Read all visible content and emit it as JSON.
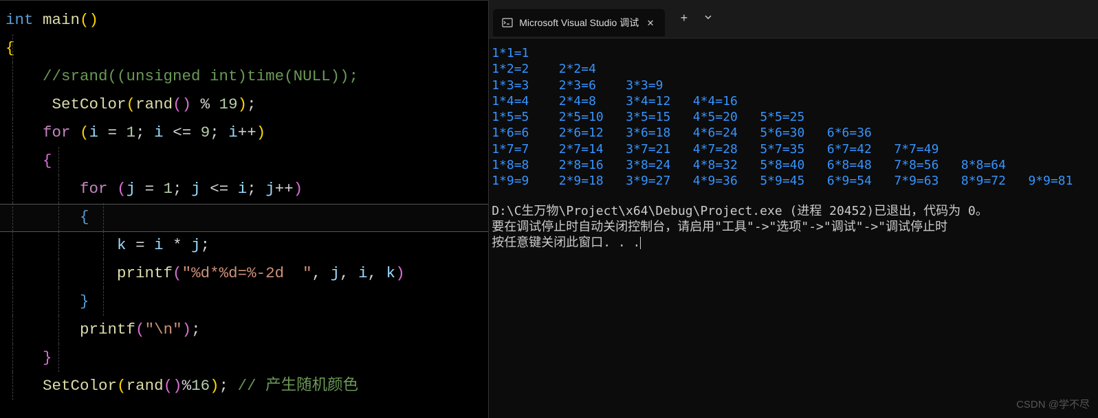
{
  "editor": {
    "code_lines": [
      [
        [
          "kw-type",
          "int "
        ],
        [
          "fn-name",
          "main"
        ],
        [
          "paren",
          "()"
        ]
      ],
      [
        [
          "brace",
          "{"
        ]
      ],
      [
        [
          "plain",
          "    "
        ],
        [
          "comment",
          "//srand((unsigned int)time(NULL));"
        ]
      ],
      [
        [
          "plain",
          "     "
        ],
        [
          "fn-name",
          "SetColor"
        ],
        [
          "paren",
          "("
        ],
        [
          "fn-name",
          "rand"
        ],
        [
          "brace2",
          "()"
        ],
        [
          "plain",
          " "
        ],
        [
          "op",
          "%"
        ],
        [
          "plain",
          " "
        ],
        [
          "num",
          "19"
        ],
        [
          "paren",
          ")"
        ],
        [
          "plain",
          ";"
        ]
      ],
      [
        [
          "plain",
          "    "
        ],
        [
          "kw",
          "for"
        ],
        [
          "plain",
          " "
        ],
        [
          "paren",
          "("
        ],
        [
          "id",
          "i"
        ],
        [
          "plain",
          " "
        ],
        [
          "op",
          "="
        ],
        [
          "plain",
          " "
        ],
        [
          "num",
          "1"
        ],
        [
          "plain",
          "; "
        ],
        [
          "id",
          "i"
        ],
        [
          "plain",
          " "
        ],
        [
          "op",
          "<="
        ],
        [
          "plain",
          " "
        ],
        [
          "num",
          "9"
        ],
        [
          "plain",
          "; "
        ],
        [
          "id",
          "i"
        ],
        [
          "op",
          "++"
        ],
        [
          "paren",
          ")"
        ]
      ],
      [
        [
          "plain",
          "    "
        ],
        [
          "brace2",
          "{"
        ]
      ],
      [
        [
          "plain",
          "        "
        ],
        [
          "kw",
          "for"
        ],
        [
          "plain",
          " "
        ],
        [
          "brace2",
          "("
        ],
        [
          "id",
          "j"
        ],
        [
          "plain",
          " "
        ],
        [
          "op",
          "="
        ],
        [
          "plain",
          " "
        ],
        [
          "num",
          "1"
        ],
        [
          "plain",
          "; "
        ],
        [
          "id",
          "j"
        ],
        [
          "plain",
          " "
        ],
        [
          "op",
          "<="
        ],
        [
          "plain",
          " "
        ],
        [
          "id",
          "i"
        ],
        [
          "plain",
          "; "
        ],
        [
          "id",
          "j"
        ],
        [
          "op",
          "++"
        ],
        [
          "brace2",
          ")"
        ]
      ],
      [
        [
          "plain",
          "        "
        ],
        [
          "brace3",
          "{"
        ]
      ],
      [
        [
          "plain",
          "            "
        ],
        [
          "id",
          "k"
        ],
        [
          "plain",
          " "
        ],
        [
          "op",
          "="
        ],
        [
          "plain",
          " "
        ],
        [
          "id",
          "i"
        ],
        [
          "plain",
          " "
        ],
        [
          "op",
          "*"
        ],
        [
          "plain",
          " "
        ],
        [
          "id",
          "j"
        ],
        [
          "plain",
          ";"
        ]
      ],
      [
        [
          "plain",
          "            "
        ],
        [
          "fn-name",
          "printf"
        ],
        [
          "brace2",
          "("
        ],
        [
          "str",
          "\"%d*%d=%-2d  \""
        ],
        [
          "plain",
          ", "
        ],
        [
          "id",
          "j"
        ],
        [
          "plain",
          ", "
        ],
        [
          "id",
          "i"
        ],
        [
          "plain",
          ", "
        ],
        [
          "id",
          "k"
        ],
        [
          "brace2",
          ")"
        ]
      ],
      [
        [
          "plain",
          "        "
        ],
        [
          "brace3",
          "}"
        ]
      ],
      [
        [
          "plain",
          "        "
        ],
        [
          "fn-name",
          "printf"
        ],
        [
          "brace2",
          "("
        ],
        [
          "str",
          "\"\\n\""
        ],
        [
          "brace2",
          ")"
        ],
        [
          "plain",
          ";"
        ]
      ],
      [
        [
          "plain",
          "    "
        ],
        [
          "brace2",
          "}"
        ]
      ],
      [
        [
          "plain",
          "    "
        ],
        [
          "fn-name",
          "SetColor"
        ],
        [
          "paren",
          "("
        ],
        [
          "fn-name",
          "rand"
        ],
        [
          "brace2",
          "()"
        ],
        [
          "op",
          "%"
        ],
        [
          "num",
          "16"
        ],
        [
          "paren",
          ")"
        ],
        [
          "plain",
          "; "
        ],
        [
          "comment",
          "// 产生随机颜色"
        ]
      ]
    ]
  },
  "terminal": {
    "tab_title": "Microsoft Visual Studio 调试",
    "table": [
      [
        "1*1=1"
      ],
      [
        "1*2=2",
        "2*2=4"
      ],
      [
        "1*3=3",
        "2*3=6",
        "3*3=9"
      ],
      [
        "1*4=4",
        "2*4=8",
        "3*4=12",
        "4*4=16"
      ],
      [
        "1*5=5",
        "2*5=10",
        "3*5=15",
        "4*5=20",
        "5*5=25"
      ],
      [
        "1*6=6",
        "2*6=12",
        "3*6=18",
        "4*6=24",
        "5*6=30",
        "6*6=36"
      ],
      [
        "1*7=7",
        "2*7=14",
        "3*7=21",
        "4*7=28",
        "5*7=35",
        "6*7=42",
        "7*7=49"
      ],
      [
        "1*8=8",
        "2*8=16",
        "3*8=24",
        "4*8=32",
        "5*8=40",
        "6*8=48",
        "7*8=56",
        "8*8=64"
      ],
      [
        "1*9=9",
        "2*9=18",
        "3*9=27",
        "4*9=36",
        "5*9=45",
        "6*9=54",
        "7*9=63",
        "8*9=72",
        "9*9=81"
      ]
    ],
    "exit_lines": [
      "D:\\C生万物\\Project\\x64\\Debug\\Project.exe (进程 20452)已退出，代码为 0。",
      "要在调试停止时自动关闭控制台，请启用\"工具\"->\"选项\"->\"调试\"->\"调试停止时",
      "按任意键关闭此窗口. . ."
    ]
  },
  "watermark": "CSDN @学不尽"
}
